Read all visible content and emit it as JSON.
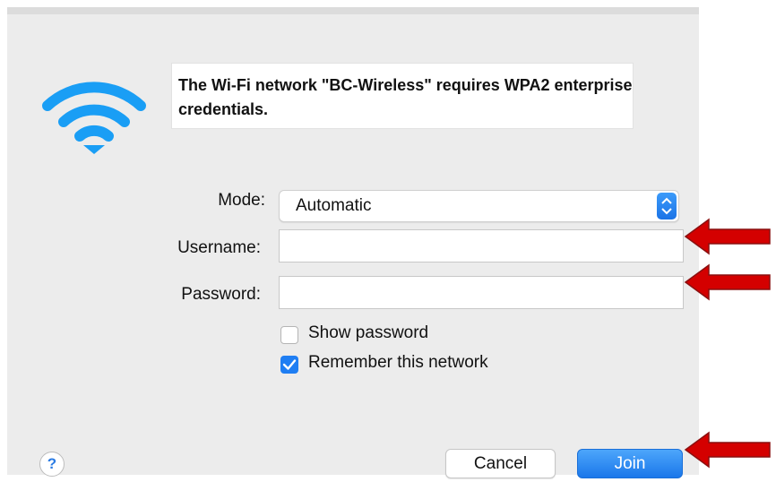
{
  "dialog": {
    "message": "The Wi-Fi network \"BC-Wireless\" requires WPA2 enterprise credentials.",
    "mode_label": "Mode:",
    "mode_value": "Automatic",
    "username_label": "Username:",
    "username_value": "",
    "password_label": "Password:",
    "password_value": "",
    "show_password_label": "Show password",
    "show_password_checked": false,
    "remember_label": "Remember this network",
    "remember_checked": true,
    "help_label": "?",
    "cancel_label": "Cancel",
    "join_label": "Join"
  },
  "colors": {
    "wifi_icon": "#1a9ef5",
    "accent": "#1f7ef3",
    "annotation_arrow": "#d40000"
  },
  "icons": [
    "wifi-icon",
    "chevron-up-down-icon",
    "checkmark-icon",
    "arrow-left-icon"
  ]
}
